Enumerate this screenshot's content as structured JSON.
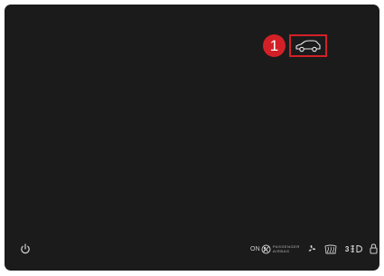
{
  "display": {
    "background_color": "#1b1b1b",
    "accent_color": "#d32027"
  },
  "callout": {
    "number": "1",
    "highlighted_icon": "car-icon"
  },
  "bottom_bar": {
    "left_icon": "power-icon",
    "airbag_indicator": {
      "state": "ON",
      "line1": "PASSENGER",
      "line2": "AIRBAG"
    },
    "icons": [
      "airbag-off-icon",
      "fan-icon",
      "windshield-defrost-icon",
      "headlight-level-icon",
      "lock-icon"
    ],
    "headlight_level": "3"
  }
}
